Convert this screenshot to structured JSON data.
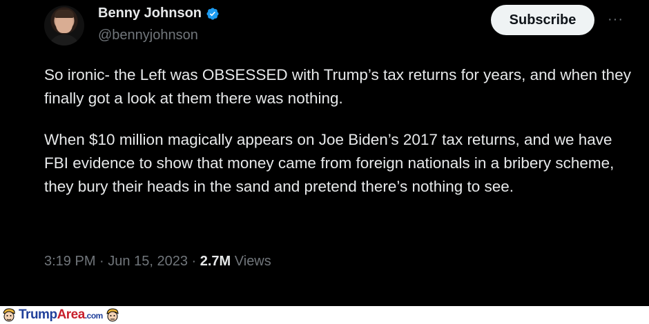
{
  "tweet": {
    "display_name": "Benny Johnson",
    "handle": "@bennyjohnson",
    "verified": true,
    "subscribe_label": "Subscribe",
    "more_label": "···",
    "paragraphs": [
      "So ironic- the Left was OBSESSED with Trump’s tax returns for years, and when they finally got a look at them there was nothing.",
      "When $10 million magically appears on Joe Biden’s 2017 tax returns, and we have FBI evidence to show that money came from foreign nationals in a bribery scheme, they bury their heads in the sand and pretend there’s nothing to see."
    ],
    "time": "3:19 PM",
    "separator": "·",
    "date": "Jun 15, 2023",
    "views_count": "2.7M",
    "views_label": "Views"
  },
  "footer": {
    "logo_text_primary": "Trump",
    "logo_text_secondary": "Area",
    "logo_text_suffix": ".com"
  },
  "colors": {
    "background": "#000000",
    "text": "#e7e9ea",
    "muted": "#71767b",
    "verified": "#1d9bf0",
    "subscribe_bg": "#eff3f4",
    "logo_blue": "#1f3f9a",
    "logo_red": "#c8202c"
  },
  "icons": {
    "verified": "verified-badge-icon",
    "more": "more-dots-icon",
    "logo_head": "caricature-head-icon"
  }
}
